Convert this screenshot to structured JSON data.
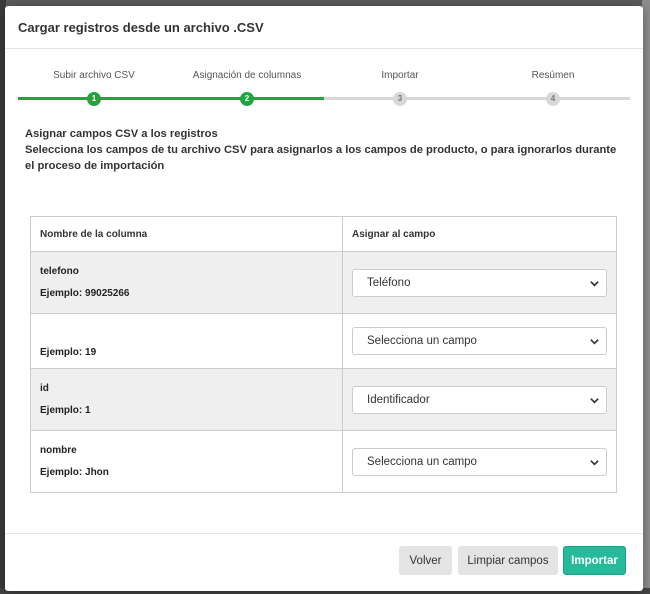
{
  "modal": {
    "title": "Cargar registros desde un archivo .CSV"
  },
  "steps": [
    {
      "label": "Subir archivo CSV",
      "number": "1",
      "state": "done"
    },
    {
      "label": "Asignación de columnas",
      "number": "2",
      "state": "done"
    },
    {
      "label": "Importar",
      "number": "3",
      "state": "pending"
    },
    {
      "label": "Resúmen",
      "number": "4",
      "state": "pending"
    }
  ],
  "intro": {
    "heading": "Asignar campos CSV a los registros",
    "description": "Selecciona los campos de tu archivo CSV para asignarlos a los campos de producto, o para ignorarlos durante el proceso de importación"
  },
  "table": {
    "headers": [
      "Nombre de la columna",
      "Asignar al campo"
    ],
    "rows": [
      {
        "name": "telefono",
        "example": "Ejemplo: 99025266",
        "field": "Teléfono"
      },
      {
        "name": "",
        "example": "Ejemplo: 19",
        "field": "Selecciona un campo"
      },
      {
        "name": "id",
        "example": "Ejemplo: 1",
        "field": "Identificador"
      },
      {
        "name": "nombre",
        "example": "Ejemplo: Jhon",
        "field": "Selecciona un campo"
      }
    ]
  },
  "footer": {
    "back": "Volver",
    "clear": "Limpiar campos",
    "import": "Importar"
  },
  "colors": {
    "progress_done": "#21a540",
    "progress_pending": "#d8d8d8",
    "primary_button": "#26b99a"
  }
}
